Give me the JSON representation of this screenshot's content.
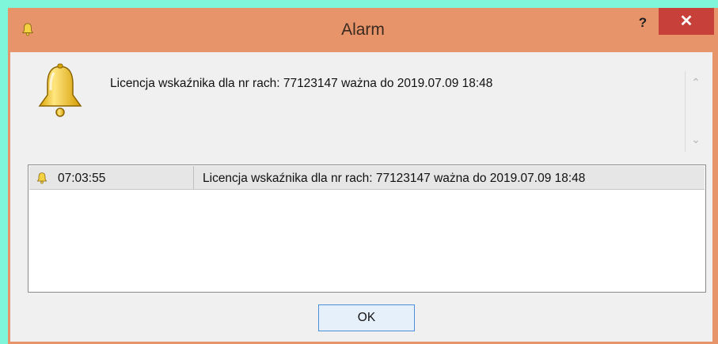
{
  "window": {
    "title": "Alarm",
    "help_label": "?",
    "close_label": "✕"
  },
  "alert": {
    "message": "Licencja wskaźnika dla nr rach: 77123147 ważna do 2019.07.09 18:48",
    "bell_icon": "bell-icon"
  },
  "scroll": {
    "up": "⌃",
    "down": "⌄"
  },
  "log": {
    "rows": [
      {
        "time": "07:03:55",
        "message": "Licencja wskaźnika dla nr rach: 77123147 ważna do 2019.07.09 18:48",
        "icon": "bell-icon"
      }
    ]
  },
  "buttons": {
    "ok": "OK"
  },
  "colors": {
    "titlebar": "#e8946a",
    "close": "#c7413a",
    "background": "#7ff5d9",
    "client": "#f0f0f0",
    "ok_border": "#4a8fd8"
  }
}
